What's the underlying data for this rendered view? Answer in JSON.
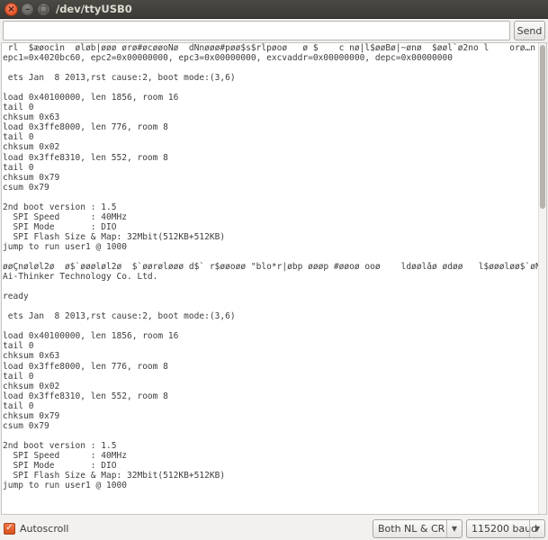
{
  "window": {
    "title": "/dev/ttyUSB0",
    "close_glyph": "×",
    "minimize_glyph": "–",
    "maximize_glyph": "□"
  },
  "send": {
    "input_value": "",
    "button_label": "Send"
  },
  "output": {
    "lines": [
      " rl  $æøocìn  øløb|øøø ørø#øcøøoNø  dNnøøø#pøø$s$rlpøoø   ø $    c nø|l$øøBø|~ønø  $øøl`ø2no l    orø…n øø",
      "epc1=0x4020bc60, epc2=0x00000000, epc3=0x00000000, excvaddr=0x00000000, depc=0x00000000",
      "",
      " ets Jan  8 2013,rst cause:2, boot mode:(3,6)",
      "",
      "load 0x40100000, len 1856, room 16",
      "tail 0",
      "chksum 0x63",
      "load 0x3ffe8000, len 776, room 8",
      "tail 0",
      "chksum 0x02",
      "load 0x3ffe8310, len 552, room 8",
      "tail 0",
      "chksum 0x79",
      "csum 0x79",
      "",
      "2nd boot version : 1.5",
      "  SPI Speed      : 40MHz",
      "  SPI Mode       : DIO",
      "  SPI Flash Size & Map: 32Mbit(512KB+512KB)",
      "jump to run user1 @ 1000",
      "",
      "øøÇnøløl2ø  ø$`øøøløl2ø  $`øørøløøø d$` r$øøoøø \"blo*r|øbp øøøp #øøoø ooø    ldøølåø ødøø   l$øøøløø$`øN",
      "Ai-Thinker Technology Co. Ltd.",
      "",
      "ready",
      "",
      " ets Jan  8 2013,rst cause:2, boot mode:(3,6)",
      "",
      "load 0x40100000, len 1856, room 16",
      "tail 0",
      "chksum 0x63",
      "load 0x3ffe8000, len 776, room 8",
      "tail 0",
      "chksum 0x02",
      "load 0x3ffe8310, len 552, room 8",
      "tail 0",
      "chksum 0x79",
      "csum 0x79",
      "",
      "2nd boot version : 1.5",
      "  SPI Speed      : 40MHz",
      "  SPI Mode       : DIO",
      "  SPI Flash Size & Map: 32Mbit(512KB+512KB)",
      "jump to run user1 @ 1000",
      ""
    ]
  },
  "footer": {
    "autoscroll_label": "Autoscroll",
    "autoscroll_checked": true,
    "check_glyph": "✓",
    "line_ending": "Both NL & CR",
    "baud_rate": "115200 baud",
    "dropdown_glyph": "▼"
  },
  "colors": {
    "accent": "#e2542a",
    "text": "#3c3c3c",
    "titlebar": "#3b3a36"
  }
}
